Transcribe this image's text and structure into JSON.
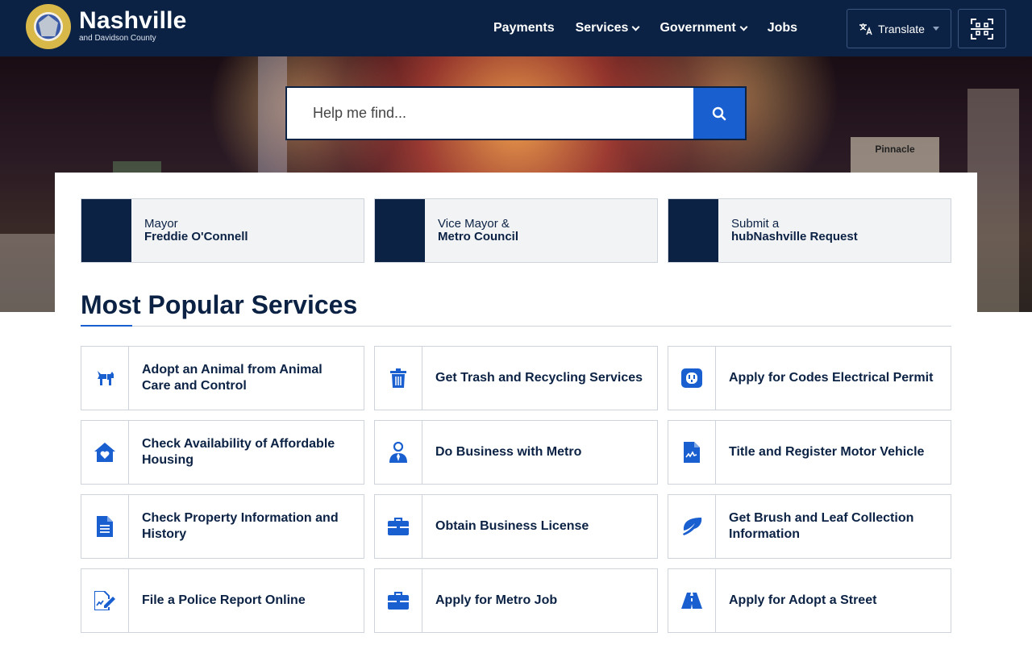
{
  "header": {
    "logo_title": "Nashville",
    "logo_sub": "and Davidson County",
    "nav": [
      {
        "label": "Payments",
        "dropdown": false
      },
      {
        "label": "Services",
        "dropdown": true
      },
      {
        "label": "Government",
        "dropdown": true
      },
      {
        "label": "Jobs",
        "dropdown": false
      }
    ],
    "translate_label": "Translate",
    "colors": {
      "navy": "#0b2244",
      "accent": "#1a5fd0"
    }
  },
  "hero": {
    "search_placeholder": "Help me find...",
    "building_sign": "Pinnacle"
  },
  "quick_links": [
    {
      "line1": "Mayor",
      "line2": "Freddie O'Connell"
    },
    {
      "line1": "Vice Mayor &",
      "line2": "Metro Council"
    },
    {
      "line1": "Submit a",
      "line2": "hubNashville Request"
    }
  ],
  "popular": {
    "title": "Most Popular Services",
    "cards": [
      {
        "label": "Adopt an Animal from Animal Care and Control",
        "icon": "dog-icon"
      },
      {
        "label": "Get Trash and Recycling Services",
        "icon": "trash-icon"
      },
      {
        "label": "Apply for Codes Electrical Permit",
        "icon": "outlet-icon"
      },
      {
        "label": "Check Availability of Affordable Housing",
        "icon": "house-heart-icon"
      },
      {
        "label": "Do Business with Metro",
        "icon": "businessperson-icon"
      },
      {
        "label": "Title and Register Motor Vehicle",
        "icon": "file-signature-icon"
      },
      {
        "label": "Check Property Information and History",
        "icon": "document-icon"
      },
      {
        "label": "Obtain Business License",
        "icon": "briefcase-icon"
      },
      {
        "label": "Get Brush and Leaf Collection Information",
        "icon": "leaf-icon"
      },
      {
        "label": "File a Police Report Online",
        "icon": "file-pen-icon"
      },
      {
        "label": "Apply for Metro Job",
        "icon": "briefcase-icon"
      },
      {
        "label": "Apply for Adopt a Street",
        "icon": "road-icon"
      }
    ]
  }
}
